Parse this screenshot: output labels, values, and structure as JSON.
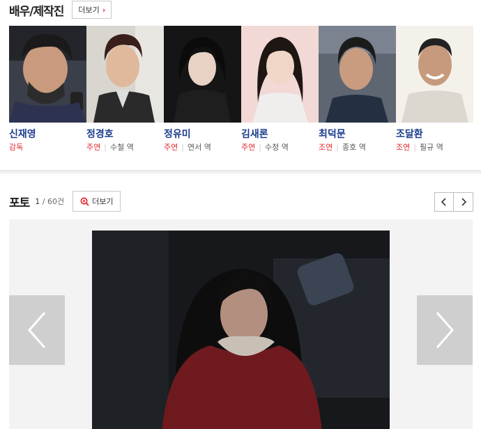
{
  "cast": {
    "title": "배우/제작진",
    "more_label": "더보기",
    "members": [
      {
        "name": "신재영",
        "type": "감독",
        "role": ""
      },
      {
        "name": "정경호",
        "type": "주연",
        "role": "수철 역"
      },
      {
        "name": "정유미",
        "type": "주연",
        "role": "연서 역"
      },
      {
        "name": "김새론",
        "type": "주연",
        "role": "수정 역"
      },
      {
        "name": "최덕문",
        "type": "조연",
        "role": "종호 역"
      },
      {
        "name": "조달환",
        "type": "조연",
        "role": "필규 역"
      }
    ]
  },
  "photo": {
    "title": "포토",
    "current": "1",
    "total": " / 60건",
    "more_label": "더보기",
    "pager": {
      "prev_icon": "chevron-left-icon",
      "next_icon": "chevron-right-icon"
    }
  },
  "colors": {
    "accent_red": "#e3262d",
    "name_blue": "#1a3c8d"
  }
}
